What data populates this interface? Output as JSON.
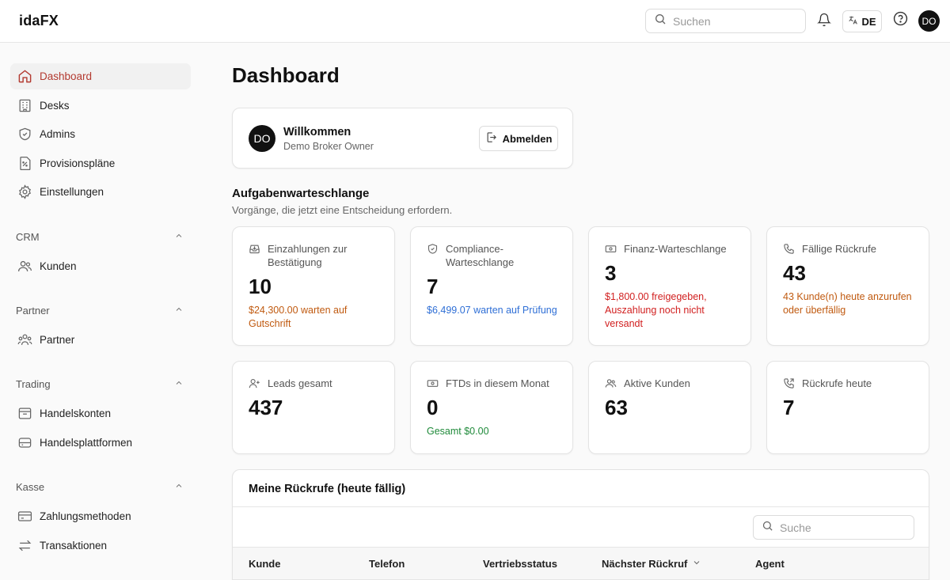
{
  "app": {
    "logo": "idaFX"
  },
  "topbar": {
    "search_placeholder": "Suchen",
    "language": "DE",
    "user_initials": "DO"
  },
  "sidebar": {
    "main_items": [
      {
        "label": "Dashboard",
        "icon": "home-icon",
        "active": true
      },
      {
        "label": "Desks",
        "icon": "building-icon"
      },
      {
        "label": "Admins",
        "icon": "shield-icon"
      },
      {
        "label": "Provisionspläne",
        "icon": "percent-document-icon"
      },
      {
        "label": "Einstellungen",
        "icon": "gear-icon"
      }
    ],
    "sections": [
      {
        "label": "CRM",
        "items": [
          {
            "label": "Kunden",
            "icon": "users-icon"
          }
        ]
      },
      {
        "label": "Partner",
        "items": [
          {
            "label": "Partner",
            "icon": "partners-icon"
          }
        ]
      },
      {
        "label": "Trading",
        "items": [
          {
            "label": "Handelskonten",
            "icon": "archive-box-icon"
          },
          {
            "label": "Handelsplattformen",
            "icon": "database-icon"
          }
        ]
      },
      {
        "label": "Kasse",
        "items": [
          {
            "label": "Zahlungsmethoden",
            "icon": "credit-card-icon"
          },
          {
            "label": "Transaktionen",
            "icon": "arrows-exchange-icon"
          }
        ]
      }
    ]
  },
  "main": {
    "title": "Dashboard",
    "welcome": {
      "initials": "DO",
      "heading": "Willkommen",
      "role": "Demo Broker Owner",
      "logout_label": "Abmelden"
    },
    "queue": {
      "title": "Aufgabenwarteschlange",
      "subtitle": "Vorgänge, die jetzt eine Entscheidung erfordern."
    },
    "queue_cards": [
      {
        "label": "Einzahlungen zur Bestätigung",
        "value": "10",
        "note": "$24,300.00 warten auf Gutschrift",
        "icon": "inbox-download-icon"
      },
      {
        "label": "Compliance-Warteschlange",
        "value": "7",
        "note": "$6,499.07 warten auf Prüfung",
        "icon": "shield-check-icon"
      },
      {
        "label": "Finanz-Warteschlange",
        "value": "3",
        "note": "$1,800.00 freigegeben, Auszahlung noch nicht versandt",
        "icon": "banknote-icon"
      },
      {
        "label": "Fällige Rückrufe",
        "value": "43",
        "note": "43 Kunde(n) heute anzurufen oder überfällig",
        "icon": "phone-icon"
      }
    ],
    "stat_cards": [
      {
        "label": "Leads gesamt",
        "value": "437",
        "note": "",
        "icon": "user-plus-icon"
      },
      {
        "label": "FTDs in diesem Monat",
        "value": "0",
        "note": "Gesamt $0.00",
        "icon": "banknote-icon"
      },
      {
        "label": "Aktive Kunden",
        "value": "63",
        "note": "",
        "icon": "users-icon"
      },
      {
        "label": "Rückrufe heute",
        "value": "7",
        "note": "",
        "icon": "phone-outgoing-icon"
      }
    ],
    "callbacks": {
      "title": "Meine Rückrufe (heute fällig)",
      "search_placeholder": "Suche",
      "columns": [
        "Kunde",
        "Telefon",
        "Vertriebsstatus",
        "Nächster Rückruf",
        "Agent"
      ]
    }
  },
  "colors": {
    "accent": "#b33a30",
    "orange": "#c05a10",
    "blue": "#2f6fd6",
    "red": "#d11f1f",
    "green": "#1f8a3a"
  }
}
